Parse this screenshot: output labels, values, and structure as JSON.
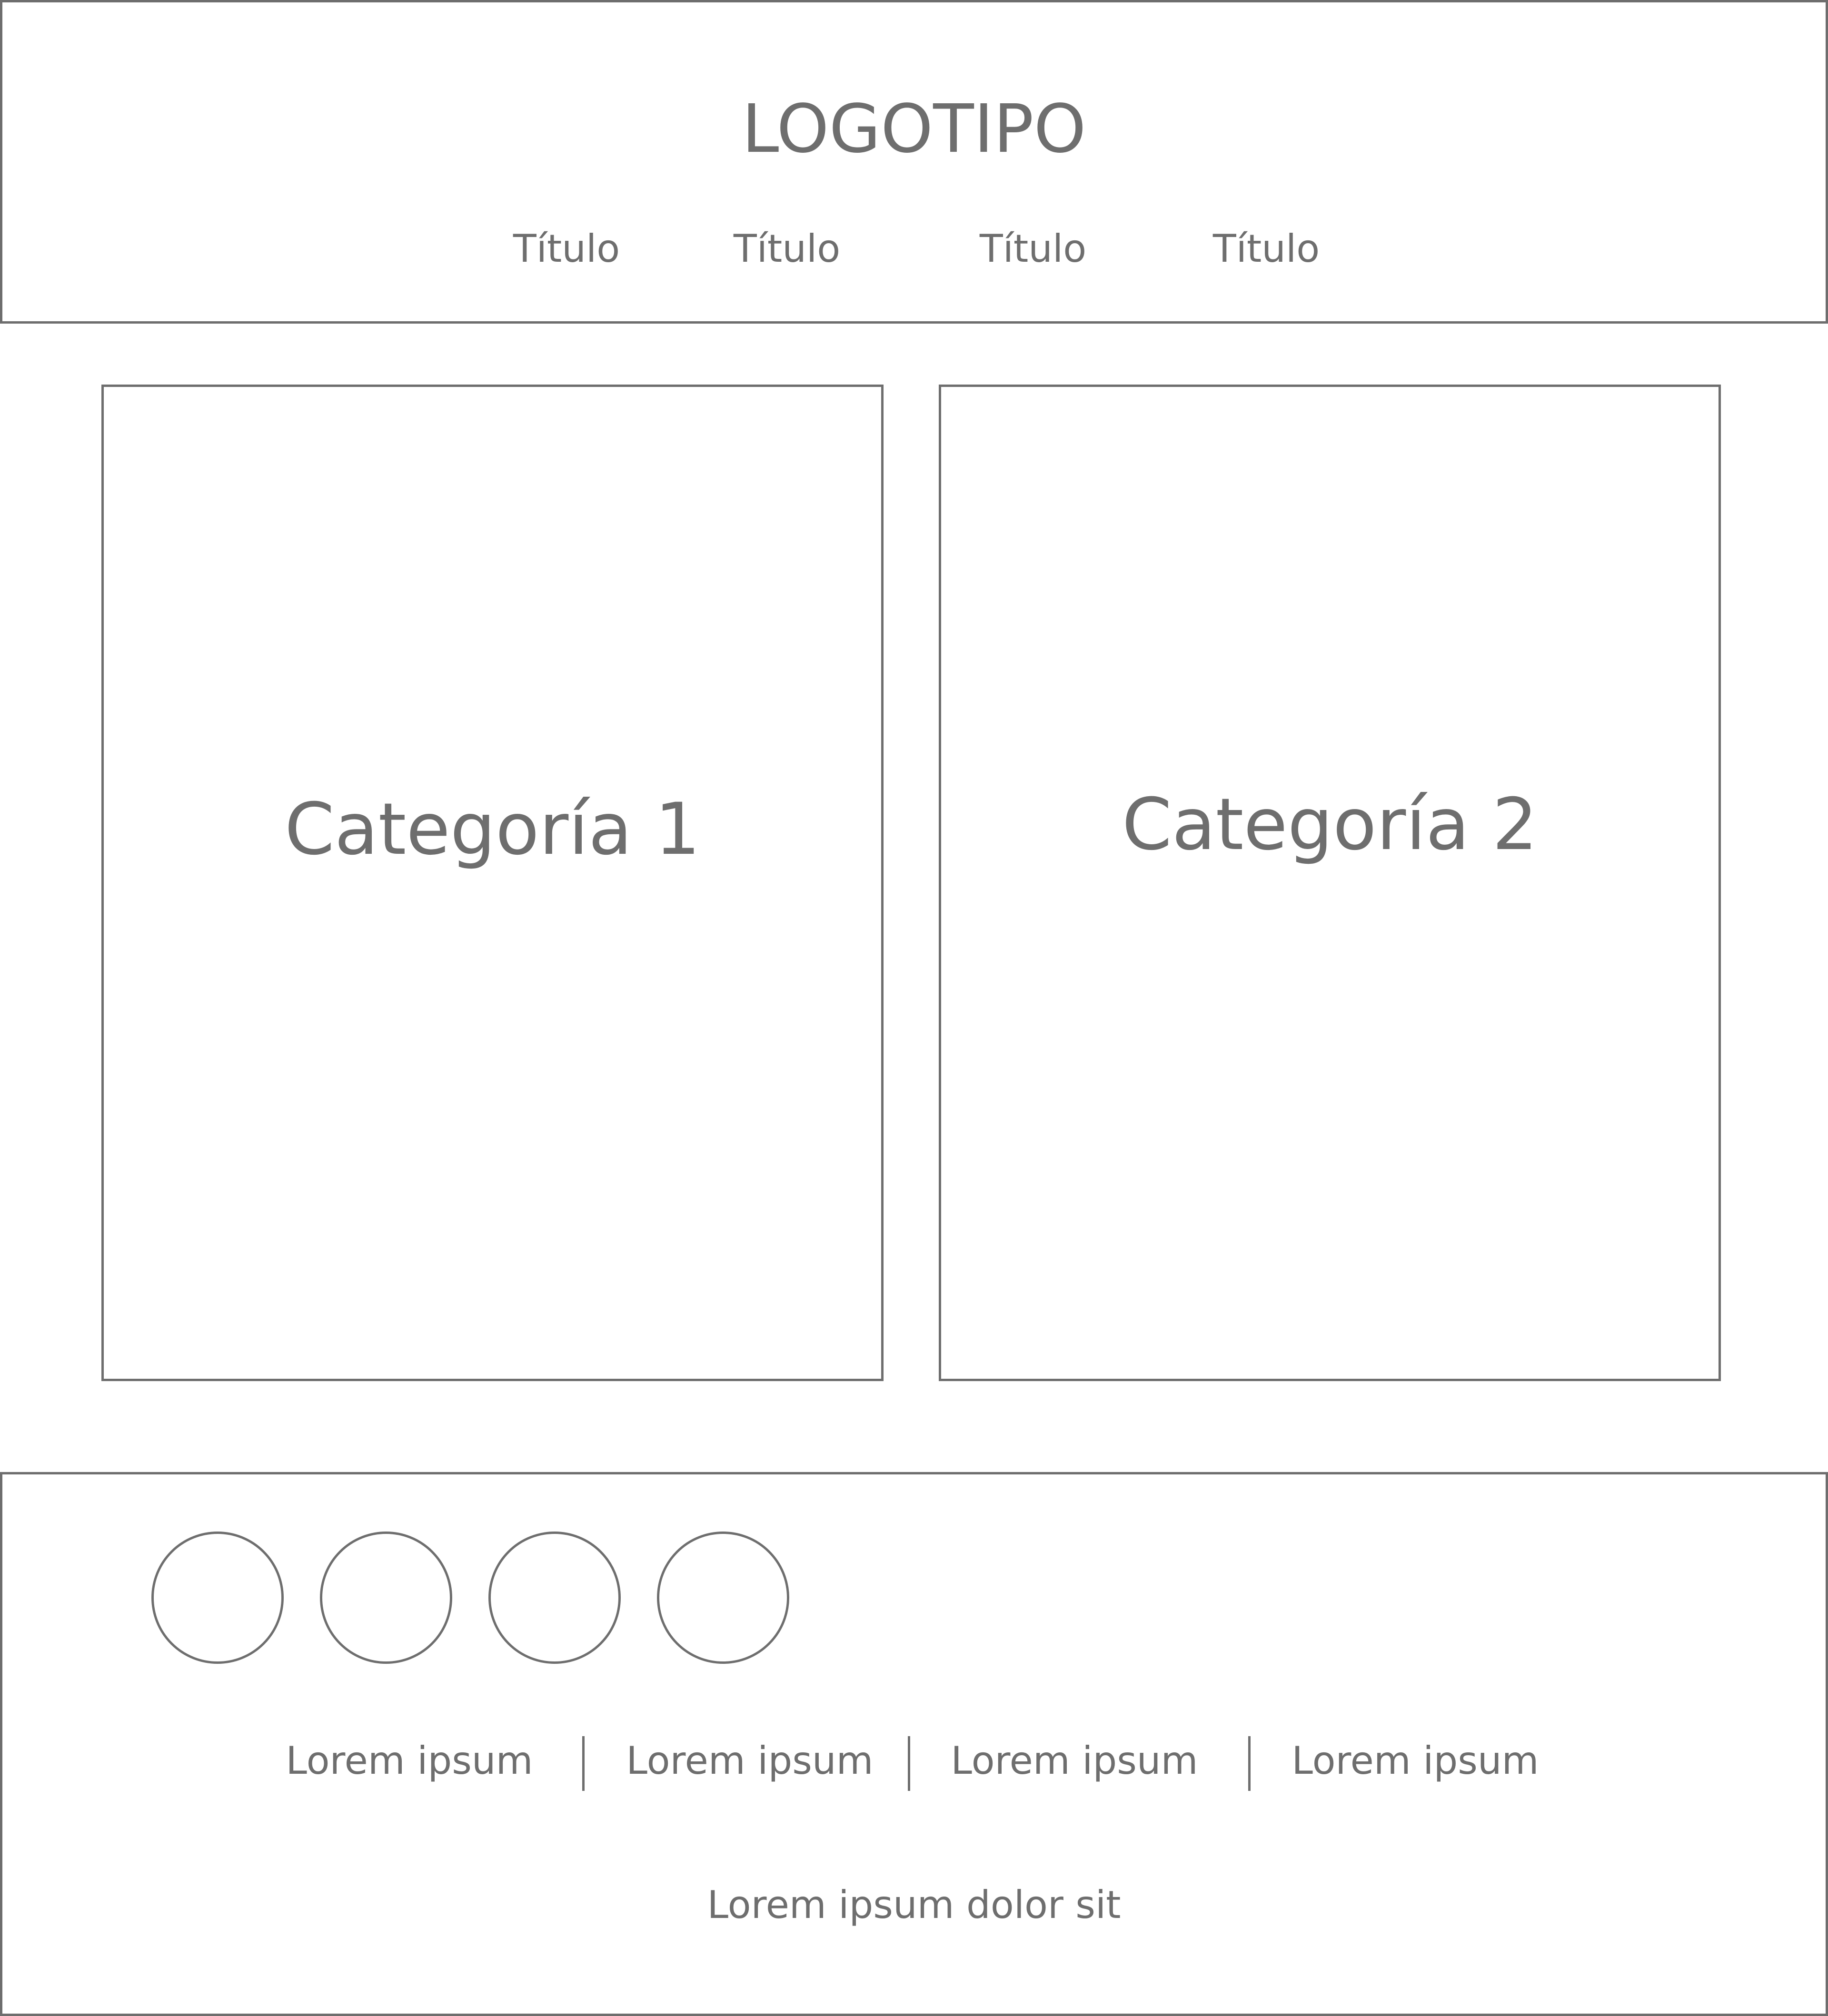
{
  "header": {
    "logo": "LOGOTIPO",
    "nav": [
      "Título",
      "Título",
      "Título",
      "Título"
    ]
  },
  "categories": [
    "Categoría 1",
    "Categoría 2"
  ],
  "footer": {
    "links": [
      "Lorem ipsum",
      "Lorem ipsum",
      "Lorem ipsum",
      "Lorem ipsum"
    ],
    "copyright": "Lorem ipsum dolor sit"
  },
  "colors": {
    "stroke": "#6e6e6e",
    "text": "#6e6e6e",
    "background": "#ffffff"
  }
}
